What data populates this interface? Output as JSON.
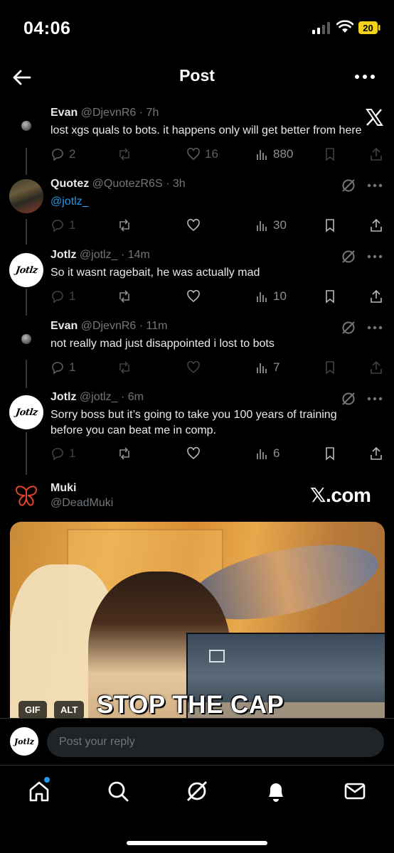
{
  "status_bar": {
    "time": "04:06",
    "battery": "20",
    "battery_color": "#f2d21b"
  },
  "header": {
    "title": "Post"
  },
  "posts": [
    {
      "name": "Evan",
      "handle": "@DjevnR6",
      "time": "· 7h",
      "text": "lost xgs quals to bots. it happens only will get better from here",
      "replies": "2",
      "reposts": "",
      "likes": "16",
      "views": "880",
      "faded": true
    },
    {
      "name": "Quotez",
      "handle": "@QuotezR6S",
      "time": "· 3h",
      "text": "@jotlz_",
      "replies": "1",
      "reposts": "",
      "likes": "",
      "views": "30",
      "faded": false
    },
    {
      "name": "Jotlz",
      "handle": "@jotlz_",
      "time": "· 14m",
      "text": "So it wasnt ragebait, he was actually mad",
      "replies": "1",
      "reposts": "",
      "likes": "",
      "views": "10",
      "faded": false
    },
    {
      "name": "Evan",
      "handle": "@DjevnR6",
      "time": "· 11m",
      "text": "not really mad just disappointed i lost to bots",
      "replies": "1",
      "reposts": "",
      "likes": "",
      "views": "7",
      "faded": true
    },
    {
      "name": "Jotlz",
      "handle": "@jotlz_",
      "time": "· 6m",
      "text": "Sorry boss but it’s going to take you 100 years of training before you can beat me in comp.",
      "replies": "1",
      "reposts": "",
      "likes": "",
      "views": "6",
      "faded": false
    }
  ],
  "avatar_text": "Jotlz",
  "muki": {
    "name": "Muki",
    "handle": "@DeadMuki",
    "brand": "𝕏.com",
    "gif_caption": "STOP THE CAP",
    "gif_badge": "GIF",
    "alt_badge": "ALT"
  },
  "reply": {
    "placeholder": "Post your reply",
    "avatar_text": "Jotlz"
  },
  "colors": {
    "accent": "#1d9bf0",
    "muted": "#71767b",
    "background": "#000000"
  }
}
